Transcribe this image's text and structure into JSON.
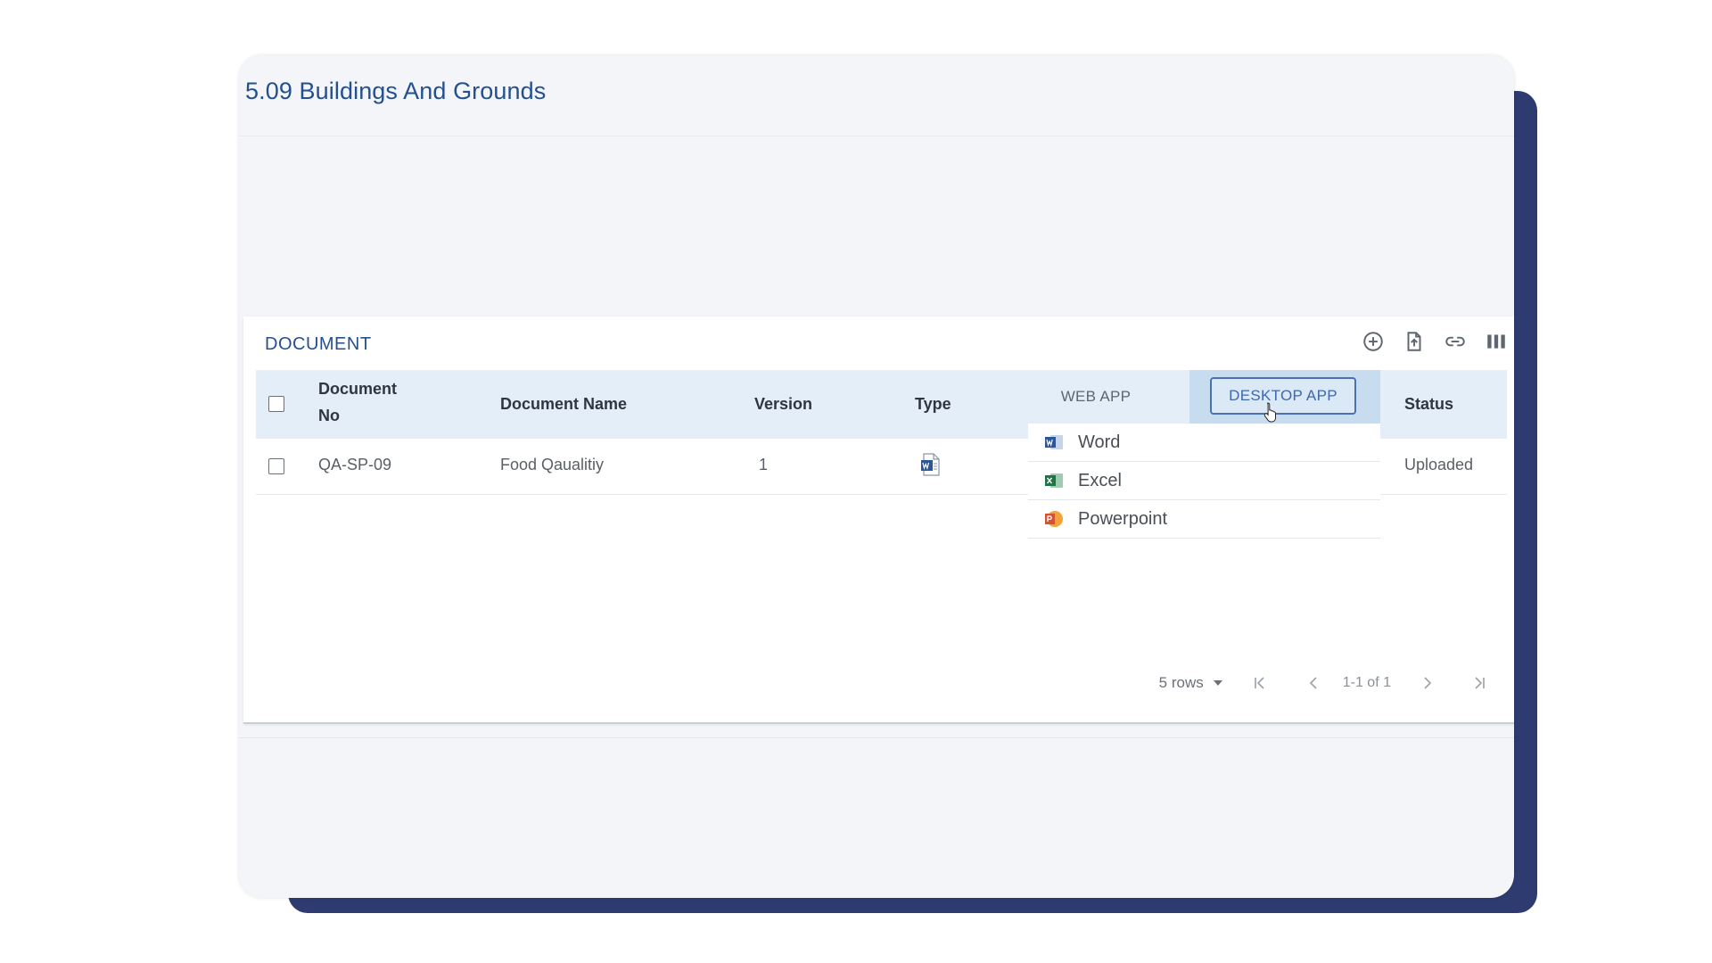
{
  "page": {
    "title": "5.09 Buildings And Grounds"
  },
  "panel": {
    "title": "DOCUMENT",
    "toolbar": [
      {
        "name": "add-circle-icon"
      },
      {
        "name": "upload-file-icon"
      },
      {
        "name": "link-icon"
      },
      {
        "name": "columns-icon"
      }
    ]
  },
  "table": {
    "headers": {
      "doc_no_line1": "Document",
      "doc_no_line2": "No",
      "doc_name": "Document Name",
      "version": "Version",
      "type": "Type",
      "status": "Status"
    },
    "rows": [
      {
        "doc_no": "QA-SP-09",
        "doc_name": "Food Qaualitiy",
        "version": "1",
        "type_icon": "word-doc-icon",
        "status": "Uploaded"
      }
    ]
  },
  "open_menu": {
    "web_app": "WEB APP",
    "desktop_app": "DESKTOP APP",
    "items": [
      {
        "label": "Word",
        "icon": "word-app-icon",
        "color": "#2b579a"
      },
      {
        "label": "Excel",
        "icon": "excel-app-icon",
        "color": "#217346"
      },
      {
        "label": "Powerpoint",
        "icon": "powerpoint-app-icon",
        "color": "#d35230"
      }
    ]
  },
  "pagination": {
    "rows_per_page": "5 rows",
    "range": "1-1 of 1"
  },
  "colors": {
    "accent": "#24508f",
    "header_bg": "#e3eef9",
    "card_shadow": "#2e3b70"
  }
}
